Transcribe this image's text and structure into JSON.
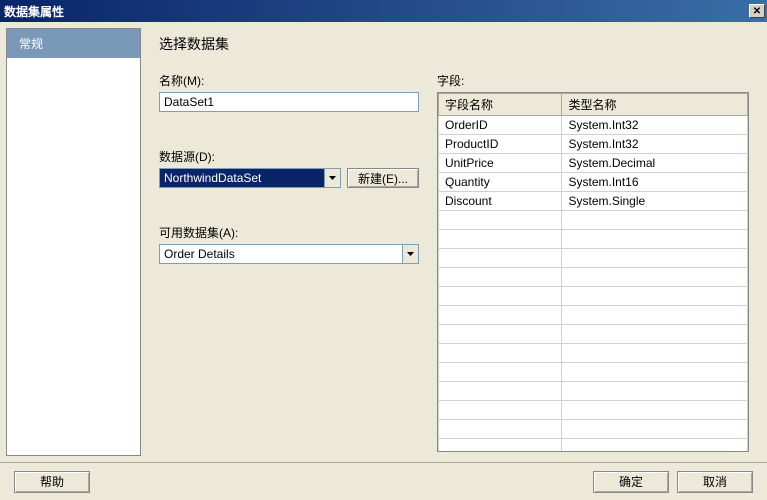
{
  "title": "数据集属性",
  "sidebar": {
    "items": [
      {
        "label": "常规"
      }
    ]
  },
  "main": {
    "page_title": "选择数据集",
    "name_label": "名称(M):",
    "name_value": "DataSet1",
    "datasource_label": "数据源(D):",
    "datasource_value": "NorthwindDataSet",
    "new_button": "新建(E)...",
    "available_label": "可用数据集(A):",
    "available_value": "Order Details",
    "fields_label": "字段:",
    "grid": {
      "col1": "字段名称",
      "col2": "类型名称",
      "rows": [
        {
          "name": "OrderID",
          "type": "System.Int32"
        },
        {
          "name": "ProductID",
          "type": "System.Int32"
        },
        {
          "name": "UnitPrice",
          "type": "System.Decimal"
        },
        {
          "name": "Quantity",
          "type": "System.Int16"
        },
        {
          "name": "Discount",
          "type": "System.Single"
        }
      ]
    }
  },
  "footer": {
    "help": "帮助",
    "ok": "确定",
    "cancel": "取消"
  }
}
